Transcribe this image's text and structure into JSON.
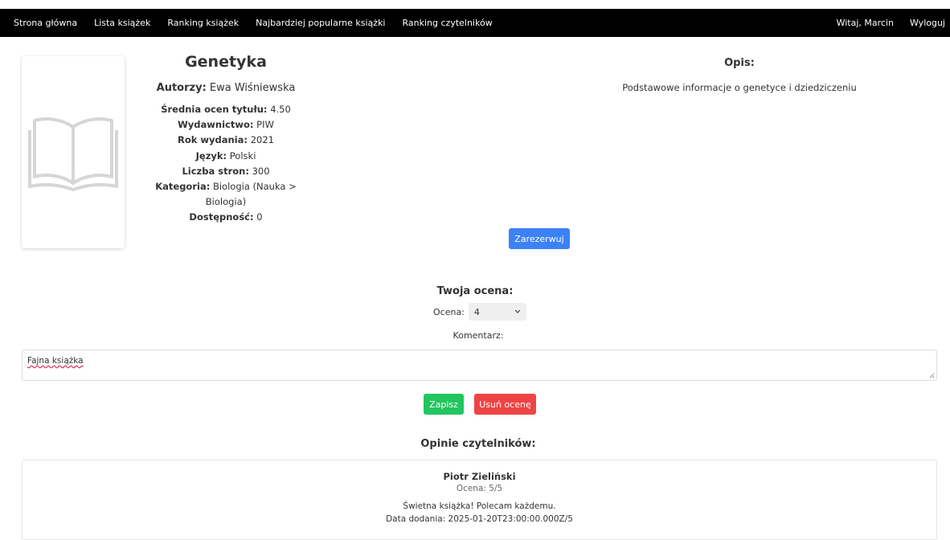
{
  "nav": {
    "left": [
      "Strona główna",
      "Lista książek",
      "Ranking książek",
      "Najbardziej popularne książki",
      "Ranking czytelników"
    ],
    "greeting": "Witaj, Marcin",
    "logout": "Wyloguj"
  },
  "book": {
    "title": "Genetyka",
    "authors_label": "Autorzy:",
    "authors": "Ewa Wiśniewska",
    "avg_label": "Średnia ocen tytułu:",
    "avg": "4.50",
    "publisher_label": "Wydawnictwo:",
    "publisher": "PIW",
    "year_label": "Rok wydania:",
    "year": "2021",
    "language_label": "Język:",
    "language": "Polski",
    "pages_label": "Liczba stron:",
    "pages": "300",
    "category_label": "Kategoria:",
    "category": "Biologia (Nauka > Biologia)",
    "availability_label": "Dostępność:",
    "availability": "0",
    "cover_icon": "open-book-icon"
  },
  "description": {
    "title": "Opis:",
    "text": "Podstawowe informacje o genetyce i dziedziczeniu"
  },
  "reserve_label": "Zarezerwuj",
  "rating": {
    "title": "Twoja ocena:",
    "score_label": "Ocena:",
    "score_value": "4",
    "comment_label": "Komentarz:",
    "comment_value": "Fajna książka",
    "save_label": "Zapisz",
    "delete_label": "Usuń ocenę"
  },
  "reviews": {
    "title": "Opinie czytelników:",
    "items": [
      {
        "author": "Piotr Zieliński",
        "score": "Ocena: 5/5",
        "text": "Świetna książka! Polecam każdemu.",
        "date": "Data dodania: 2025-01-20T23:00:00.000Z/5"
      }
    ]
  },
  "colors": {
    "navbar": "#000000",
    "reserve": "#3b82f6",
    "save": "#22c55e",
    "delete": "#ef4444"
  }
}
